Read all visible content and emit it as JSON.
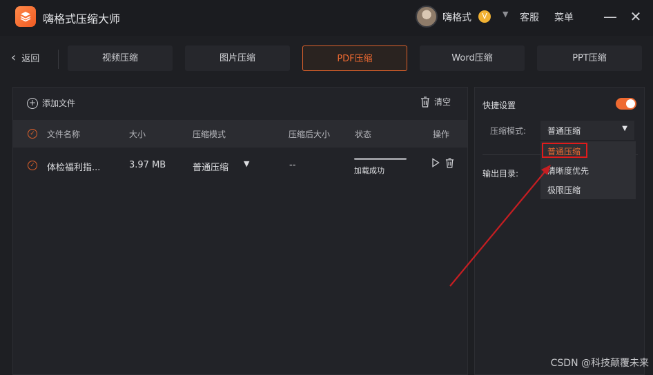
{
  "app": {
    "title": "嗨格式压缩大师"
  },
  "titlebar": {
    "username": "嗨格式",
    "vip_badge": "V",
    "support_label": "客服",
    "menu_label": "菜单"
  },
  "nav": {
    "back_label": "返回",
    "tabs": [
      {
        "label": "视频压缩"
      },
      {
        "label": "图片压缩"
      },
      {
        "label": "PDF压缩",
        "active": true
      },
      {
        "label": "Word压缩"
      },
      {
        "label": "PPT压缩"
      }
    ]
  },
  "file_panel": {
    "add_file_label": "添加文件",
    "clear_label": "清空",
    "columns": {
      "name": "文件名称",
      "size": "大小",
      "mode": "压缩模式",
      "after_size": "压缩后大小",
      "status": "状态",
      "ops": "操作"
    },
    "rows": [
      {
        "name": "体检福利指...",
        "size": "3.97 MB",
        "mode": "普通压缩",
        "after_size": "--",
        "status": "加载成功",
        "progress": 1.0
      }
    ]
  },
  "settings": {
    "title": "快捷设置",
    "toggle_on": true,
    "mode_label": "压缩模式:",
    "mode_value": "普通压缩",
    "output_label": "输出目录:",
    "options": [
      "普通压缩",
      "清晰度优先",
      "极限压缩"
    ]
  },
  "watermark": "CSDN @科技颠覆未来",
  "colors": {
    "accent": "#ef6a31",
    "highlight_box": "#e01b1b",
    "arrow": "#c61e22"
  }
}
